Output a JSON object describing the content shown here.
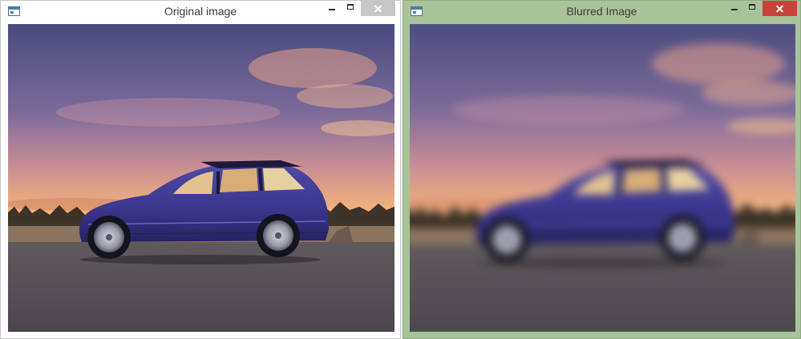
{
  "windows": [
    {
      "title": "Original image",
      "close_color": "#c7c7c7",
      "frame_color": "#ffffff",
      "icons": [
        "window-app-icon",
        "minimize-icon",
        "maximize-icon",
        "close-icon"
      ],
      "image": "sunset photo of a blue station wagon car"
    },
    {
      "title": "Blurred Image",
      "close_color": "#c8423a",
      "frame_color": "#a9c39a",
      "icons": [
        "window-app-icon",
        "minimize-icon",
        "maximize-icon",
        "close-icon"
      ],
      "image": "blurred sunset photo of a blue station wagon car"
    }
  ]
}
